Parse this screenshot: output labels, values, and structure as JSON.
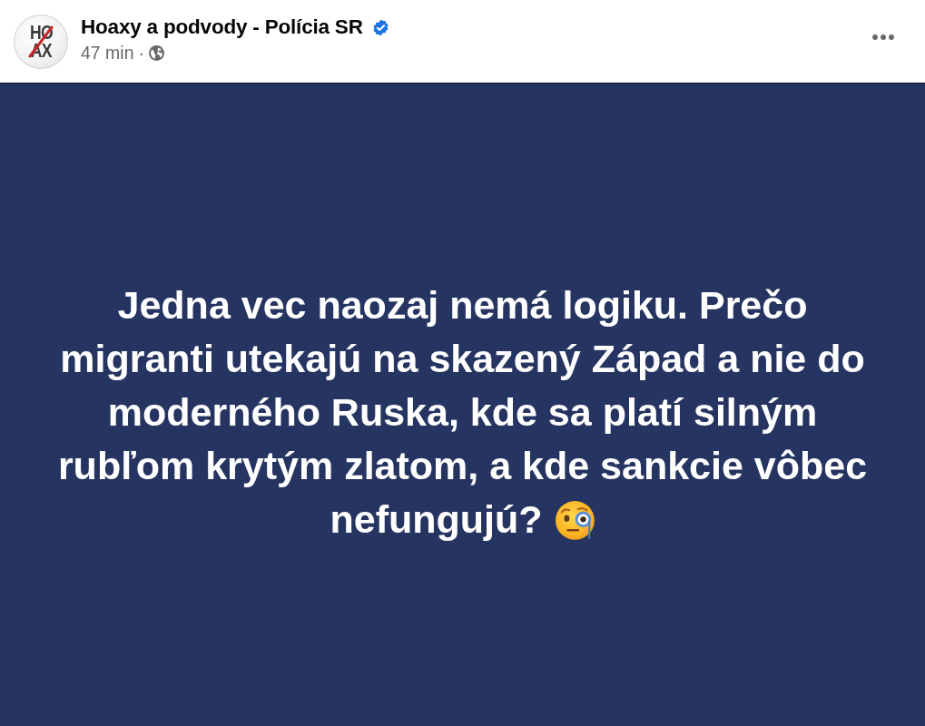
{
  "post_header": {
    "avatar": {
      "logo_lines": [
        "HO",
        "AX"
      ]
    },
    "author": "Hoaxy a podvody - Polícia SR",
    "verified": true,
    "time": "47 min",
    "separator": "·",
    "public": true
  },
  "post_card": {
    "text_lines": [
      "Jedna vec naozaj nemá logiku. Prečo",
      "migranti utekajú na skazený Západ a nie do",
      "moderného Ruska, kde sa platí silným",
      "rubľom krytým zlatom, a kde sankcie vôbec",
      "nefungujú?"
    ]
  }
}
